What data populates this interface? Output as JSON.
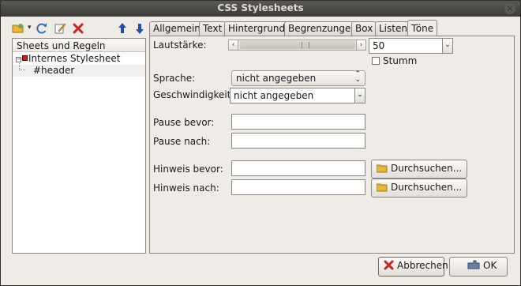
{
  "window": {
    "title": "CSS Stylesheets",
    "close_glyph": "×"
  },
  "toolbar": {
    "icons": [
      "open-icon",
      "dropdown-arrow-icon",
      "refresh-icon",
      "edit-icon",
      "delete-icon",
      "arrow-up-icon",
      "arrow-down-icon"
    ],
    "dropdown_glyph": "▾",
    "up_glyph": "⬆",
    "down_glyph": "⬇"
  },
  "tree": {
    "header": "Sheets und Regeln",
    "expander_glyph": "−",
    "items": [
      {
        "label": "Internes Stylesheet"
      },
      {
        "label": "#header"
      }
    ]
  },
  "tabs": [
    {
      "label": "Allgemein"
    },
    {
      "label": "Text"
    },
    {
      "label": "Hintergrund"
    },
    {
      "label": "Begrenzungen"
    },
    {
      "label": "Box"
    },
    {
      "label": "Listen"
    },
    {
      "label": "Töne",
      "active": true
    }
  ],
  "form": {
    "volume_label": "Lautstärke:",
    "volume_value": "50",
    "volume_slider_level": 0.5,
    "mute_label": "Stumm",
    "mute_checked": false,
    "language_label": "Sprache:",
    "language_value": "nicht angegeben",
    "speed_label": "Geschwindigkeit:",
    "speed_value": "nicht angegeben",
    "pause_before_label": "Pause bevor:",
    "pause_before_value": "",
    "pause_after_label": "Pause nach:",
    "pause_after_value": "",
    "cue_before_label": "Hinweis bevor:",
    "cue_before_value": "",
    "cue_after_label": "Hinweis nach:",
    "cue_after_value": "",
    "browse_label": "Durchsuchen...",
    "combo_glyph": "⌄",
    "select_up_glyph": "⌃",
    "select_down_glyph": "⌄",
    "slider_left_glyph": "‹",
    "slider_right_glyph": "›"
  },
  "footer": {
    "cancel_label": "Abbrechen",
    "ok_label": "OK"
  },
  "colors": {
    "titlebar": "#3c3b37",
    "window_bg": "#efebe7",
    "delete_red": "#cc2222",
    "folder_yellow": "#e8b83a",
    "arrow_blue": "#1f4fa8"
  }
}
